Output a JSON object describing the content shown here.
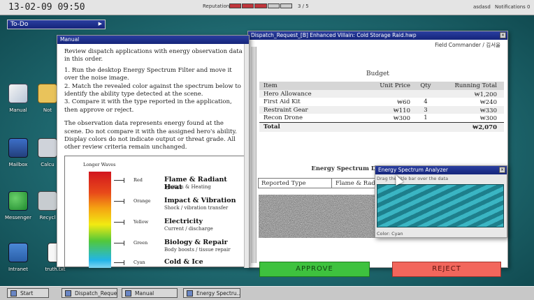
{
  "topbar": {
    "clock": "13-02-09 09:50",
    "reputation_label": "Reputation",
    "reputation_value": 3,
    "reputation_max": 5,
    "reputation_count": "3 / 5",
    "user": "asdasd",
    "notifications": "Notifications 0"
  },
  "todo": {
    "label": "To-Do"
  },
  "desktop_icons": {
    "manual": "Manual",
    "notes": "Not",
    "mailbox": "Mailbox",
    "calculator": "Calcu",
    "messenger": "Messenger",
    "recycle": "Recycl",
    "intranet": "Intranet",
    "truth": "truth.txt"
  },
  "manual": {
    "title": "Manual",
    "intro": "Review dispatch applications with energy observation data in this order.",
    "step1": "1. Run the desktop Energy Spectrum Filter and move it over the noise image.",
    "step2": "2. Match the revealed color against the spectrum below to identify the ability type detected at the scene.",
    "step3": "3. Compare it with the type reported in the application, then approve or reject.",
    "note": "The observation data represents energy found at the scene. Do not compare it with the assigned hero's ability. Display colors do not indicate output or threat grade. All other review criteria remain unchanged.",
    "spectrum_label": "Longer Waves",
    "spectrum": [
      {
        "color": "Red",
        "name": "Flame & Radiant Heat",
        "sub": "Ignition & Heating"
      },
      {
        "color": "Orange",
        "name": "Impact & Vibration",
        "sub": "Shock / vibration transfer"
      },
      {
        "color": "Yellow",
        "name": "Electricity",
        "sub": "Current / discharge"
      },
      {
        "color": "Green",
        "name": "Biology & Repair",
        "sub": "Body boosts / tissue repair"
      },
      {
        "color": "Cyan",
        "name": "Cold & Ice",
        "sub": ""
      }
    ]
  },
  "dispatch": {
    "title": "Dispatch_Request_[B] Enhanced Villain: Cold Storage Raid.hwp",
    "field_commander": "Field Commander / 김서울",
    "budget_title": "Budget",
    "headers": {
      "item": "Item",
      "price": "Unit Price",
      "qty": "Qty",
      "running": "Running Total"
    },
    "rows": [
      {
        "item": "Hero Allowance",
        "price": "",
        "qty": "",
        "running": "₩1,200"
      },
      {
        "item": "First Aid Kit",
        "price": "₩60",
        "qty": "4",
        "running": "₩240"
      },
      {
        "item": "Restraint Gear",
        "price": "₩110",
        "qty": "3",
        "running": "₩330"
      },
      {
        "item": "Recon Drone",
        "price": "₩300",
        "qty": "1",
        "running": "₩300"
      }
    ],
    "total_label": "Total",
    "total_value": "₩2,070",
    "energy_title": "Energy Spectrum Detected at the Scene",
    "reported_type_label": "Reported Type",
    "reported_type_value": "Flame & Radia",
    "approve": "APPROVE",
    "reject": "REJECT"
  },
  "analyzer": {
    "title": "Energy Spectrum Analyzer",
    "hint": "Drag the title bar over the data",
    "color": "Color: Cyan"
  },
  "taskbar": {
    "start": "Start",
    "items": [
      "Dispatch_Reque...",
      "Manual",
      "Energy Spectru..."
    ]
  }
}
